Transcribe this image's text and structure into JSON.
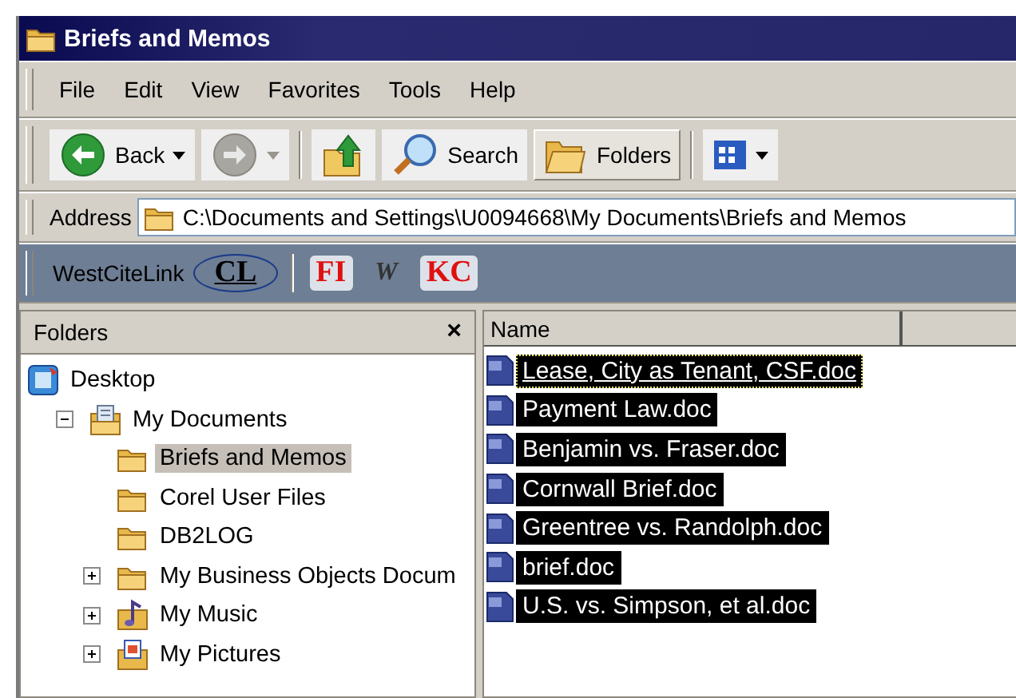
{
  "window": {
    "title": "Briefs and Memos"
  },
  "menu": [
    {
      "label": "File"
    },
    {
      "label": "Edit"
    },
    {
      "label": "View"
    },
    {
      "label": "Favorites"
    },
    {
      "label": "Tools"
    },
    {
      "label": "Help"
    }
  ],
  "toolbar": [
    {
      "kind": "back",
      "label": "Back",
      "selected": false
    },
    {
      "kind": "forward",
      "selected": false
    },
    {
      "kind": "up",
      "selected": false
    },
    {
      "kind": "search",
      "label": "Search",
      "selected": false
    },
    {
      "kind": "folders",
      "label": "Folders",
      "selected": true
    },
    {
      "kind": "views",
      "selected": false
    }
  ],
  "address": {
    "label": "Address",
    "value": "C:\\Documents and Settings\\U0094668\\My Documents\\Briefs and Memos"
  },
  "links_bar": {
    "label": "WestCiteLink",
    "links": [
      {
        "kind": "circled",
        "label": "CL",
        "color": "#000000"
      },
      {
        "kind": "plain",
        "label": "FI",
        "color": "#e01010"
      },
      {
        "kind": "logo",
        "label": "W",
        "color": "#333333"
      },
      {
        "kind": "plain",
        "label": "KC",
        "color": "#e01010"
      }
    ]
  },
  "folders_pane": {
    "title": "Folders",
    "close": "×",
    "tree": [
      {
        "label": "Desktop",
        "kind": "desktop",
        "selected": false,
        "children": [
          {
            "label": "My Documents",
            "kind": "documents",
            "expanded": true,
            "selected": false,
            "children": [
              {
                "label": "Briefs and Memos",
                "kind": "folder",
                "selected": true
              },
              {
                "label": "Corel User Files",
                "kind": "folder",
                "selected": false
              },
              {
                "label": "DB2LOG",
                "kind": "folder",
                "selected": false
              },
              {
                "label": "My Business Objects Docum",
                "kind": "folder",
                "expanded": false,
                "selected": false
              },
              {
                "label": "My Music",
                "kind": "music",
                "expanded": false,
                "selected": false
              },
              {
                "label": "My Pictures",
                "kind": "pictures",
                "expanded": false,
                "selected": false
              }
            ]
          }
        ]
      }
    ]
  },
  "file_list": {
    "columns": [
      {
        "label": "Name"
      }
    ],
    "files": [
      {
        "name": "Lease, City as Tenant, CSF.doc",
        "selected": true,
        "focused": true
      },
      {
        "name": "Payment Law.doc",
        "selected": true,
        "focused": false
      },
      {
        "name": "Benjamin vs. Fraser.doc",
        "selected": true,
        "focused": false
      },
      {
        "name": "Cornwall Brief.doc",
        "selected": true,
        "focused": false
      },
      {
        "name": "Greentree vs. Randolph.doc",
        "selected": true,
        "focused": false
      },
      {
        "name": "brief.doc",
        "selected": true,
        "focused": false
      },
      {
        "name": "U.S. vs. Simpson, et al.doc",
        "selected": true,
        "focused": false
      }
    ]
  }
}
